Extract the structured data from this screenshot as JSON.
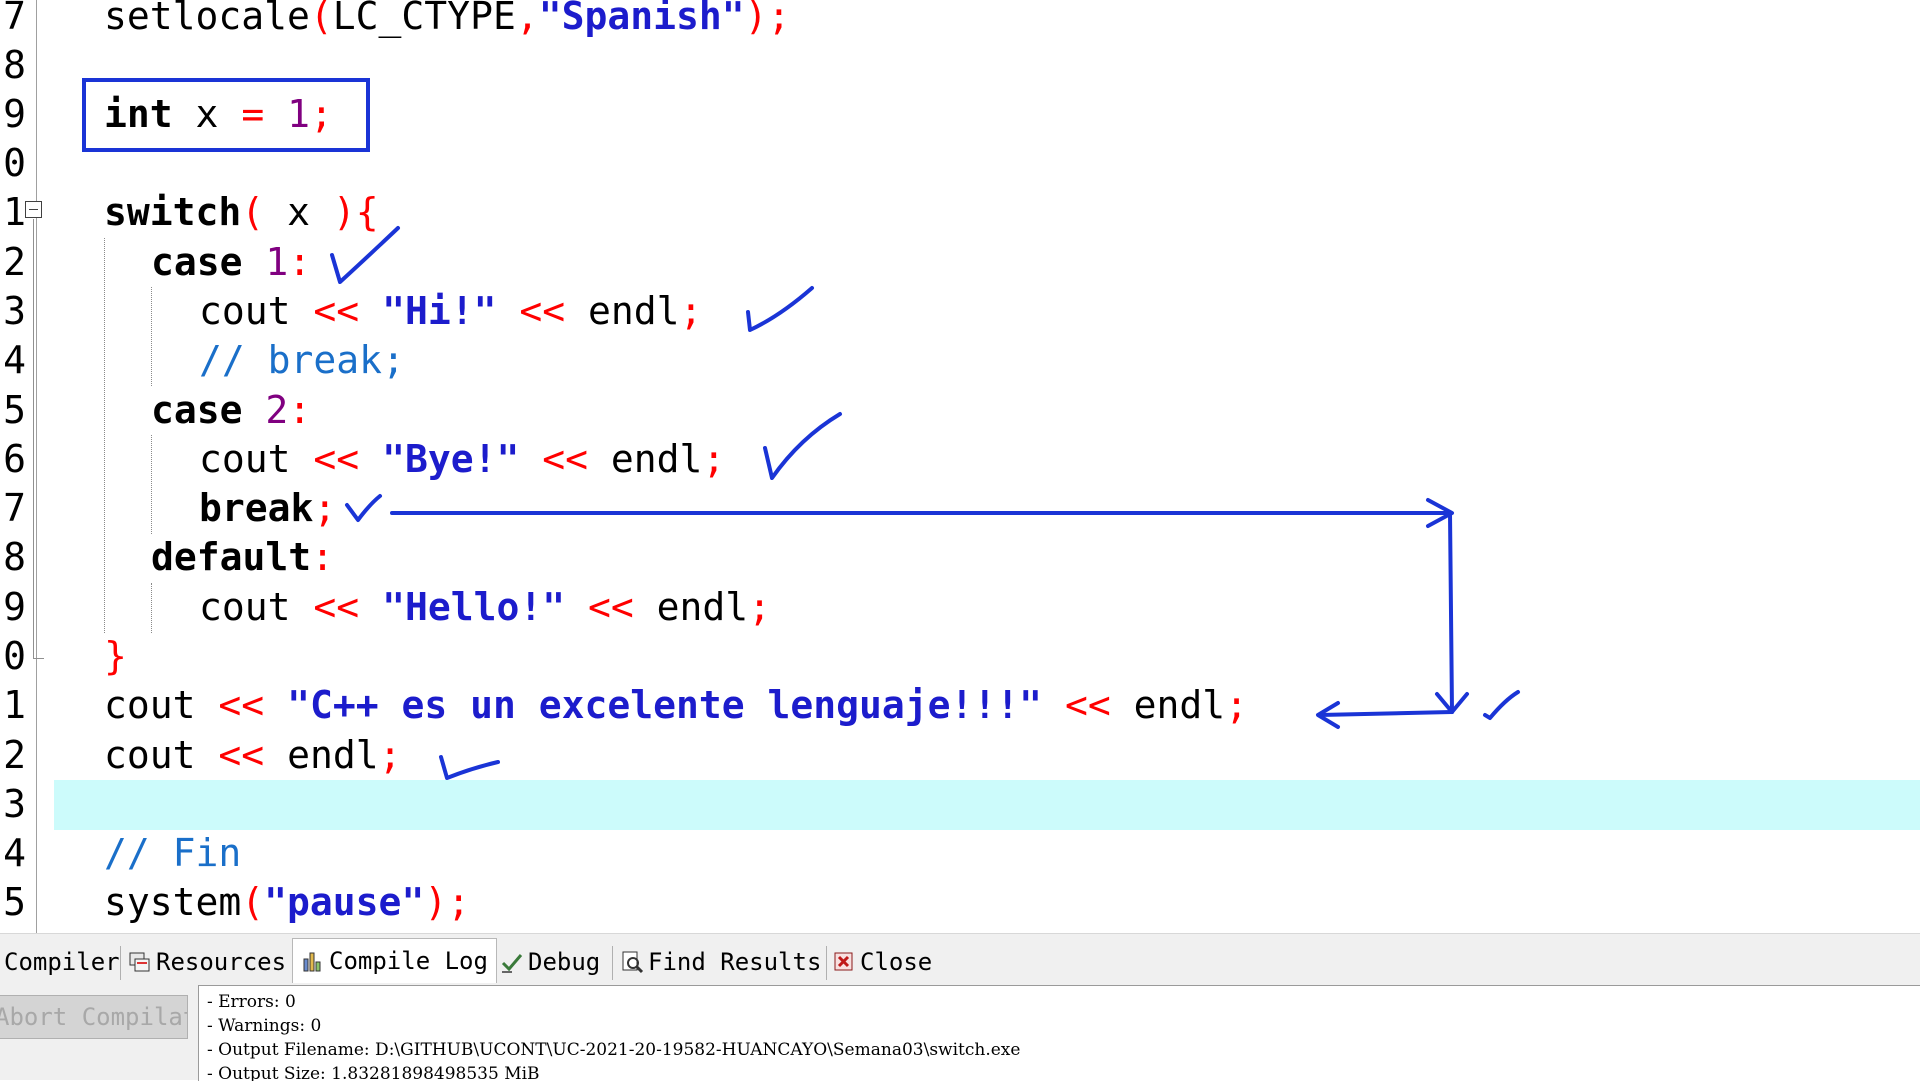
{
  "editor": {
    "line_numbers": [
      "7",
      "8",
      "9",
      "0",
      "1",
      "2",
      "3",
      "4",
      "5",
      "6",
      "7",
      "8",
      "9",
      "0",
      "1",
      "2",
      "3",
      "4",
      "5"
    ],
    "lines": {
      "l7": {
        "fn": "setlocale",
        "p1": "(",
        "arg": "LC_CTYPE",
        "comma": ",",
        "str": "\"Spanish\"",
        "end": ");"
      },
      "l9": {
        "kw": "int",
        "var": "x",
        "eq": "=",
        "num": "1",
        "semi": ";"
      },
      "l11": {
        "kw": "switch",
        "p1": "(",
        "var": "x",
        "end": "){"
      },
      "l12": {
        "kw": "case",
        "num": "1",
        "colon": ":"
      },
      "l13": {
        "id": "cout",
        "op1": "<<",
        "str": "\"Hi!\"",
        "op2": "<<",
        "endl": "endl",
        "semi": ";"
      },
      "l14": {
        "cmt": "// break;"
      },
      "l15": {
        "kw": "case",
        "num": "2",
        "colon": ":"
      },
      "l16": {
        "id": "cout",
        "op1": "<<",
        "str": "\"Bye!\"",
        "op2": "<<",
        "endl": "endl",
        "semi": ";"
      },
      "l17": {
        "kw": "break",
        "semi": ";"
      },
      "l18": {
        "kw": "default",
        "colon": ":"
      },
      "l19": {
        "id": "cout",
        "op1": "<<",
        "str": "\"Hello!\"",
        "op2": "<<",
        "endl": "endl",
        "semi": ";"
      },
      "l20": {
        "brace": "}"
      },
      "l21": {
        "id": "cout",
        "op1": "<<",
        "str": "\"C++ es un excelente lenguaje!!!\"",
        "op2": "<<",
        "endl": "endl",
        "semi": ";"
      },
      "l22": {
        "id": "cout",
        "op1": "<<",
        "endl": "endl",
        "semi": ";"
      },
      "l24": {
        "cmt": "// Fin"
      },
      "l25": {
        "fn": "system",
        "p1": "(",
        "str": "\"pause\"",
        "end": ");"
      }
    }
  },
  "panel": {
    "tabs": {
      "compiler": "Compiler",
      "resources": "Resources",
      "compile_log": "Compile Log",
      "debug": "Debug",
      "find_results": "Find Results",
      "close": "Close"
    },
    "abort_button": "Abort Compilation",
    "log": [
      "- Errors: 0",
      "- Warnings: 0",
      "- Output Filename: D:\\GITHUB\\UCONT\\UC-2021-20-19582-HUANCAYO\\Semana03\\switch.exe",
      "- Output Size: 1.83281898498535 MiB"
    ]
  },
  "colors": {
    "annotation": "#1a34d6",
    "current_line": "#ccfbfb",
    "keyword": "#000000",
    "operator": "#ff0000",
    "string": "#1c1ccc",
    "number": "#800080",
    "comment": "#1a6fc9"
  }
}
